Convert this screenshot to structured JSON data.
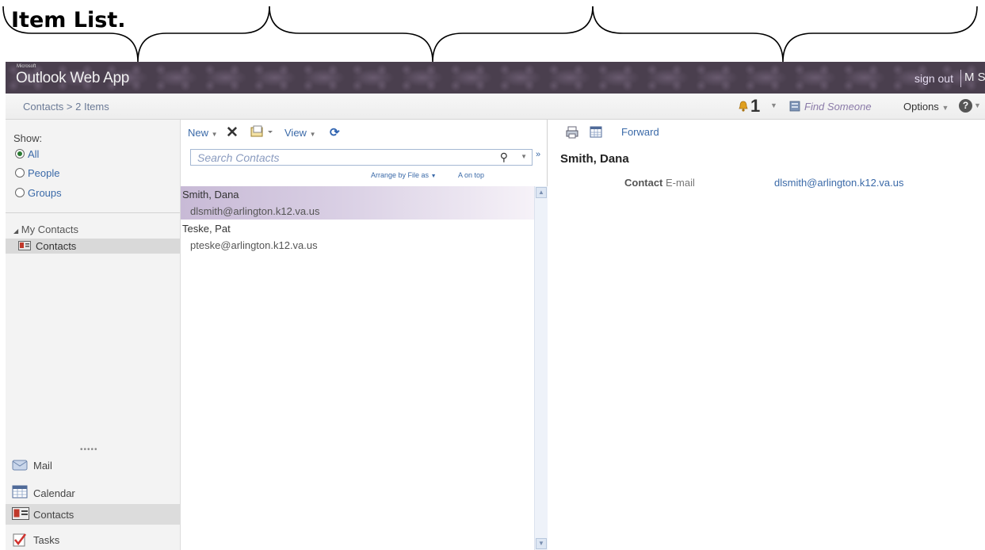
{
  "annotation": {
    "title": "Item List."
  },
  "header": {
    "brand_small": "Microsoft",
    "app_title": "Outlook Web App",
    "sign_out": "sign out",
    "user": "M S"
  },
  "breadcrumb": {
    "text": "Contacts > 2 Items",
    "reminder_count": "1",
    "find_someone": "Find Someone",
    "options": "Options",
    "help": "?"
  },
  "sidebar": {
    "show_label": "Show:",
    "filters": [
      "All",
      "People",
      "Groups"
    ],
    "selected_filter": "All",
    "group_label": "My Contacts",
    "folder": "Contacts",
    "dots": "•••••",
    "nav": [
      "Mail",
      "Calendar",
      "Contacts",
      "Tasks"
    ],
    "active_nav": "Contacts"
  },
  "toolbar": {
    "new_label": "New",
    "view_label": "View"
  },
  "search": {
    "placeholder": "Search Contacts"
  },
  "list": {
    "arrange_label": "Arrange by File as",
    "order_label": "A on top",
    "items": [
      {
        "name": "Smith, Dana",
        "email": "dlsmith@arlington.k12.va.us",
        "selected": true
      },
      {
        "name": "Teske, Pat",
        "email": "pteske@arlington.k12.va.us",
        "selected": false
      }
    ]
  },
  "reading": {
    "forward_label": "Forward",
    "name": "Smith, Dana",
    "field_label_bold": "Contact",
    "field_label": "E-mail",
    "email": "dlsmith@arlington.k12.va.us"
  },
  "colors": {
    "header_bg": "#4a3f4e",
    "link": "#3b6aa8",
    "selected_row": "#c8bad6"
  }
}
